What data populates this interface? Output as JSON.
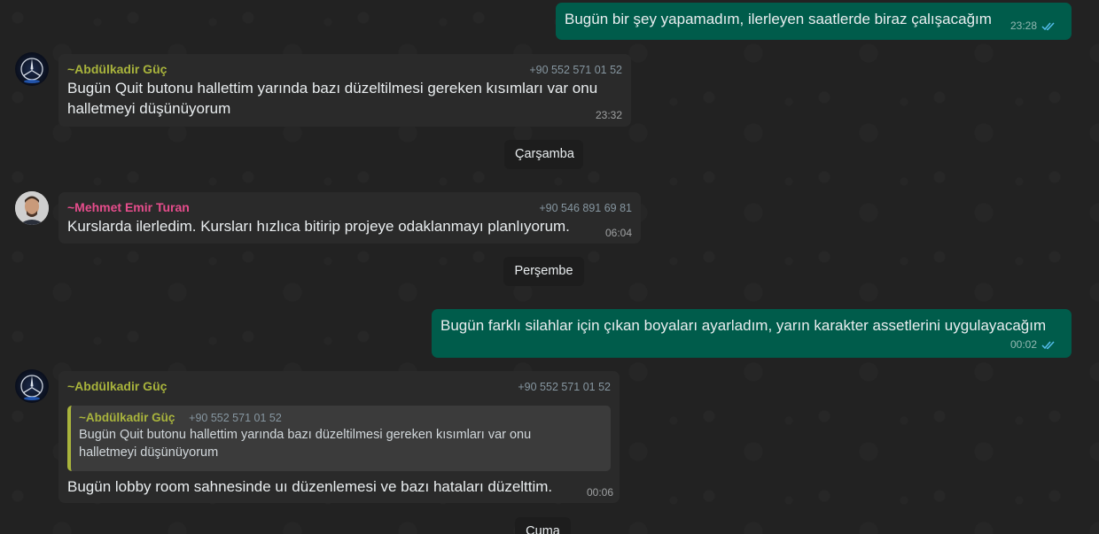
{
  "colors": {
    "outgoing_bubble": "#005c4b",
    "incoming_bubble": "#2a2a2a",
    "name_abdulkadir": "#a9b43c",
    "name_mehmet": "#e64d8c",
    "tick_read": "#53bdeb"
  },
  "messages": [
    {
      "direction": "outgoing",
      "text": "Bugün bir şey yapamadım, ilerleyen saatlerde biraz çalışacağım",
      "time": "23:28",
      "status_icon": "double-check-read-icon"
    },
    {
      "direction": "incoming",
      "sender": "~Abdülkadir Güç",
      "phone": "+90 552 571 01 52",
      "text_line1": "Bugün Quit butonu hallettim yarında bazı düzeltilmesi gereken kısımları var onu",
      "text_line2": "halletmeyi düşünüyorum",
      "time": "23:32",
      "avatar_icon": "mercedes-logo-avatar"
    },
    {
      "direction": "date",
      "text": "Çarşamba"
    },
    {
      "direction": "incoming",
      "sender": "~Mehmet Emir Turan",
      "phone": "+90 546 891 69 81",
      "text": "Kurslarda ilerledim. Kursları  hızlıca bitirip projeye odaklanmayı planlıyorum.",
      "time": "06:04",
      "avatar_icon": "person-photo-avatar"
    },
    {
      "direction": "date",
      "text": "Perşembe"
    },
    {
      "direction": "outgoing",
      "text": "Bugün farklı silahlar için çıkan boyaları ayarladım, yarın karakter assetlerini uygulayacağım",
      "time": "00:02",
      "status_icon": "double-check-read-icon"
    },
    {
      "direction": "incoming",
      "sender": "~Abdülkadir Güç",
      "phone": "+90 552 571 01 52",
      "quote": {
        "sender": "~Abdülkadir Güç",
        "phone": "+90 552 571 01 52",
        "text_line1": "Bugün Quit butonu hallettim yarında bazı düzeltilmesi gereken kısımları var onu",
        "text_line2": "halletmeyi düşünüyorum"
      },
      "text": "Bugün lobby room sahnesinde uı düzenlemesi ve bazı hataları düzelttim.",
      "time": "00:06",
      "avatar_icon": "mercedes-logo-avatar"
    },
    {
      "direction": "date",
      "text": "Cuma"
    }
  ]
}
